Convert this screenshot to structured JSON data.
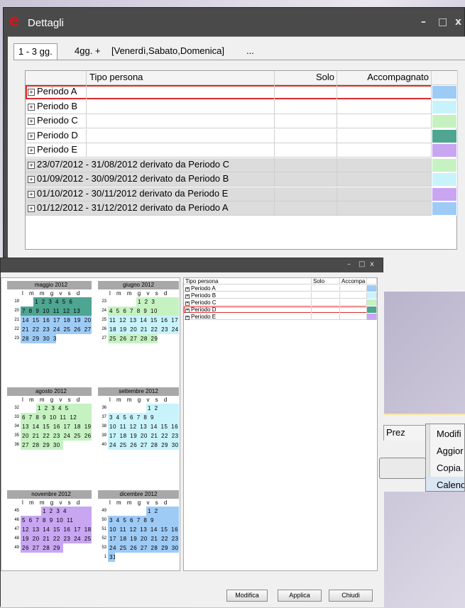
{
  "main_window": {
    "logo": "e",
    "title": "Dettagli",
    "controls": [
      "–",
      "□",
      "x"
    ],
    "tabs": [
      "1 - 3 gg.",
      "4gg. +",
      "[Venerdì,Sabato,Domenica]",
      "..."
    ],
    "columns": [
      "Tipo persona",
      "Solo",
      "Accompagnato"
    ],
    "rows": [
      {
        "label": "Periodo A",
        "color": "#9ecbf5",
        "derived": false
      },
      {
        "label": "Periodo B",
        "color": "#c9f3fb",
        "derived": false
      },
      {
        "label": "Periodo C",
        "color": "#c6f2c2",
        "derived": false
      },
      {
        "label": "Periodo D",
        "color": "#4ea592",
        "derived": false
      },
      {
        "label": "Periodo E",
        "color": "#c8a6f2",
        "derived": false
      },
      {
        "label": "23/07/2012 - 31/08/2012 derivato da Periodo C",
        "color": "#c6f2c2",
        "derived": true
      },
      {
        "label": "01/09/2012 - 30/09/2012 derivato da Periodo B",
        "color": "#c9f3fb",
        "derived": true
      },
      {
        "label": "01/10/2012 - 30/11/2012 derivato da Periodo E",
        "color": "#c8a6f2",
        "derived": true
      },
      {
        "label": "01/12/2012 - 31/12/2012 derivato da Periodo A",
        "color": "#9ecbf5",
        "derived": true
      }
    ]
  },
  "secondary_window": {
    "controls": [
      "–",
      "□",
      "x"
    ],
    "calendar": {
      "dow": "l m m g v s d",
      "months": [
        {
          "name": "maggio 2012",
          "weeks": [
            [
              "19",
              "1 2 3 4 5 6"
            ],
            [
              "20",
              "7 8 9 10 11 12 13"
            ],
            [
              "21",
              "14 15 16 17 18 19 20"
            ],
            [
              "22",
              "21 22 23 24 25 26 27"
            ],
            [
              "23",
              "28 29 30 31"
            ]
          ],
          "next_arrow": ""
        },
        {
          "name": "giugno 2012",
          "weeks": [
            [
              "23",
              "1 2 3"
            ],
            [
              "24",
              "4 5 6 7 8 9 10"
            ],
            [
              "25",
              "11 12 13 14 15 16 17"
            ],
            [
              "26",
              "18 19 20 21 22 23 24"
            ],
            [
              "27",
              "25 26 27 28 29 30"
            ]
          ],
          "next_arrow": "▶"
        },
        {
          "name": "agosto 2012",
          "weeks": [
            [
              "32",
              "1 2 3 4 5"
            ],
            [
              "33",
              "6 7 8 9 10 11 12"
            ],
            [
              "34",
              "13 14 15 16 17 18 19"
            ],
            [
              "35",
              "20 21 22 23 24 25 26"
            ],
            [
              "36",
              "27 28 29 30 31"
            ]
          ],
          "next_arrow": ""
        },
        {
          "name": "settembre 2012",
          "weeks": [
            [
              "36",
              "1 2"
            ],
            [
              "37",
              "3 4 5 6 7 8 9"
            ],
            [
              "38",
              "10 11 12 13 14 15 16"
            ],
            [
              "39",
              "17 18 19 20 21 22 23"
            ],
            [
              "40",
              "24 25 26 27 28 29 30"
            ]
          ],
          "next_arrow": ""
        },
        {
          "name": "novembre 2012",
          "weeks": [
            [
              "45",
              "1 2 3 4"
            ],
            [
              "46",
              "5 6 7 8 9 10 11"
            ],
            [
              "47",
              "12 13 14 15 16 17 18"
            ],
            [
              "48",
              "19 20 21 22 23 24 25"
            ],
            [
              "49",
              "26 27 28 29 30"
            ]
          ],
          "next_arrow": ""
        },
        {
          "name": "dicembre 2012",
          "weeks": [
            [
              "49",
              "1 2"
            ],
            [
              "50",
              "3 4 5 6 7 8 9"
            ],
            [
              "51",
              "10 11 12 13 14 15 16"
            ],
            [
              "52",
              "17 18 19 20 21 22 23"
            ],
            [
              "53",
              "24 25 26 27 28 29 30"
            ],
            [
              "1",
              "31"
            ]
          ],
          "next_arrow": ""
        }
      ]
    },
    "columns": [
      "Tipo persona",
      "Solo",
      "Accompa"
    ],
    "rows": [
      {
        "label": "Periodo A",
        "color": "#9ecbf5"
      },
      {
        "label": "Periodo B",
        "color": "#c9f3fb"
      },
      {
        "label": "Periodo C",
        "color": "#c6f2c2"
      },
      {
        "label": "Periodo D",
        "color": "#4ea592"
      },
      {
        "label": "Periodo E",
        "color": "#c8a6f2"
      }
    ],
    "buttons": [
      "Modifica",
      "Applica",
      "Chiudi"
    ]
  },
  "behind_panel": {
    "tab_label": "Prez"
  },
  "context_menu": {
    "items": [
      "Modifi",
      "Aggior",
      "Copia.",
      "Calend"
    ]
  },
  "colors": {
    "periodo_a": "#9ecbf5",
    "periodo_b": "#c9f3fb",
    "periodo_c": "#c6f2c2",
    "periodo_d": "#4ea592",
    "periodo_e": "#c8a6f2",
    "selection": "#e02a2a"
  }
}
